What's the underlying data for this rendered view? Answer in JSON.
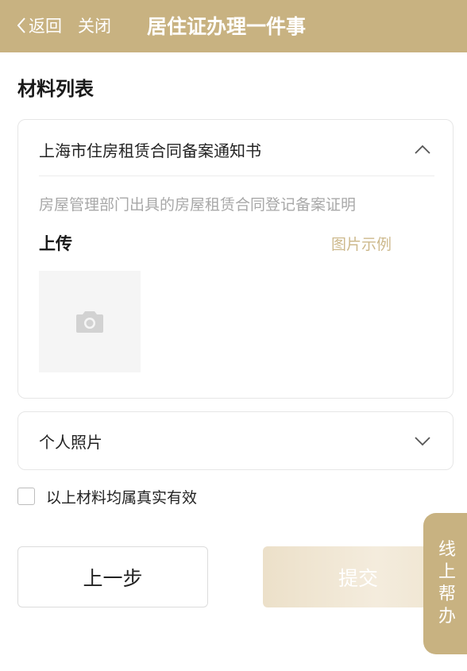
{
  "header": {
    "back_label": "返回",
    "close_label": "关闭",
    "title": "居住证办理一件事",
    "bg_color": "#c8b281"
  },
  "section": {
    "title": "材料列表"
  },
  "materials": [
    {
      "name": "上海市住房租赁合同备案通知书",
      "expanded": true,
      "description": "房屋管理部门出具的房屋租赁合同登记备案证明",
      "upload_label": "上传",
      "example_link": "图片示例",
      "upload_icon": "camera-icon"
    },
    {
      "name": "个人照片",
      "expanded": false
    }
  ],
  "agreement": {
    "checked": false,
    "text": "以上材料均属真实有效"
  },
  "buttons": {
    "prev_label": "上一步",
    "submit_label": "提交"
  },
  "help_tab": {
    "chars": [
      "线",
      "上",
      "帮",
      "办"
    ]
  }
}
